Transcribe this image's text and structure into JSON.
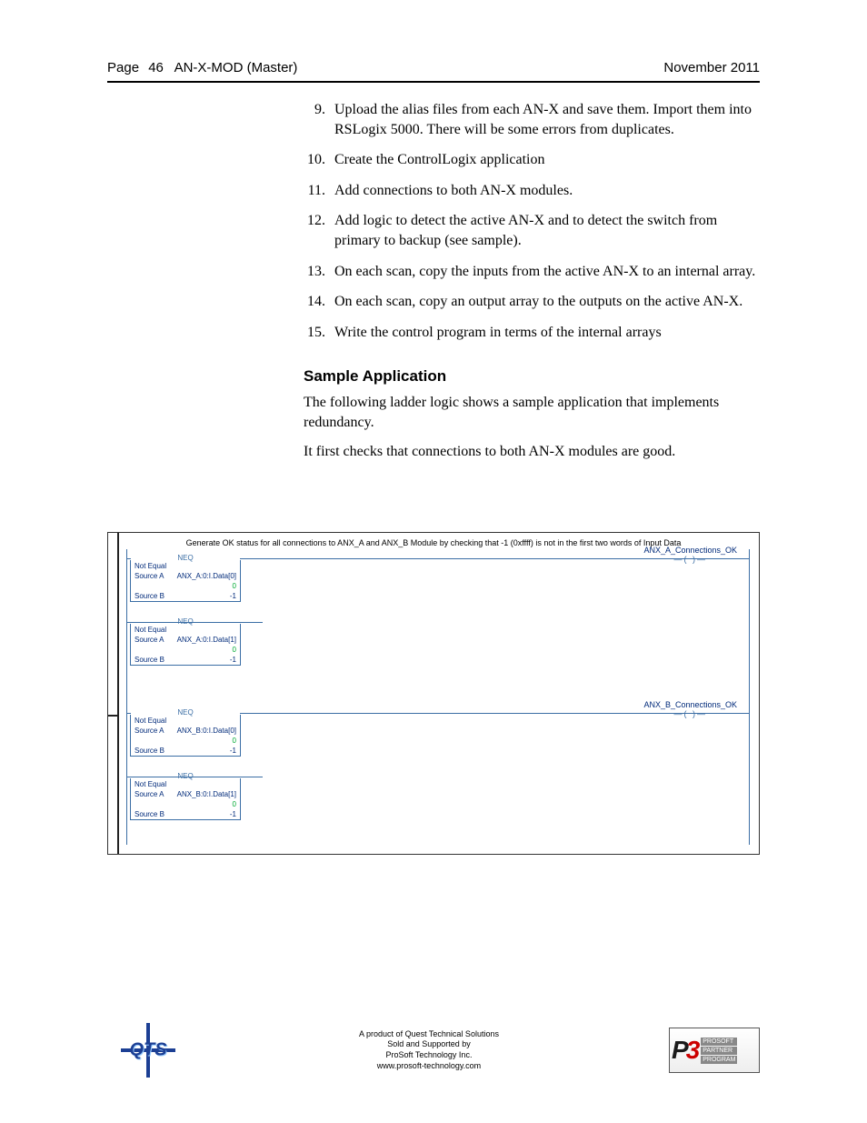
{
  "header": {
    "page_label": "Page",
    "page_number": "46",
    "doc_title": "AN-X-MOD (Master)",
    "date": "November 2011"
  },
  "steps_start": 9,
  "steps": [
    "Upload the alias files from each AN-X and save them.  Import them into RSLogix 5000.  There will be some errors from duplicates.",
    "Create the ControlLogix application",
    "Add connections to both AN-X modules.",
    "Add logic to detect the active AN-X and to detect the switch from primary to backup (see sample).",
    "On each scan, copy the inputs from the active AN-X to an internal array.",
    "On each scan, copy an output array to the outputs on the active AN-X.",
    "Write the control program in terms of the internal arrays"
  ],
  "section_heading": "Sample Application",
  "para1": "The following ladder logic shows a sample application that implements redundancy.",
  "para2": "It first checks that connections to both AN-X modules are good.",
  "ladder": {
    "caption": "Generate OK status for all connections to ANX_A and ANX_B Module by checking that -1 (0xffff) is not in the first two words of Input Data",
    "neq_title": "NEQ",
    "not_equal": "Not Equal",
    "source_a": "Source A",
    "source_b": "Source B",
    "val_zero": "0",
    "val_neg1": "-1",
    "rungs": [
      {
        "coil": "ANX_A_Connections_OK",
        "blocks": [
          {
            "sa_tag": "ANX_A:0:I.Data[0]"
          },
          {
            "sa_tag": "ANX_A:0:I.Data[1]"
          }
        ]
      },
      {
        "coil": "ANX_B_Connections_OK",
        "blocks": [
          {
            "sa_tag": "ANX_B:0:I.Data[0]"
          },
          {
            "sa_tag": "ANX_B:0:I.Data[1]"
          }
        ]
      }
    ]
  },
  "footer": {
    "line1": "A product of Quest Technical Solutions",
    "line2": "Sold and Supported by",
    "line3": "ProSoft Technology Inc.",
    "line4": "www.prosoft-technology.com",
    "qts": "QTS",
    "p3_p": "P",
    "p3_3": "3",
    "p3_l1": "PROSOFT",
    "p3_l2": "PARTNER",
    "p3_l3": "PROGRAM"
  }
}
